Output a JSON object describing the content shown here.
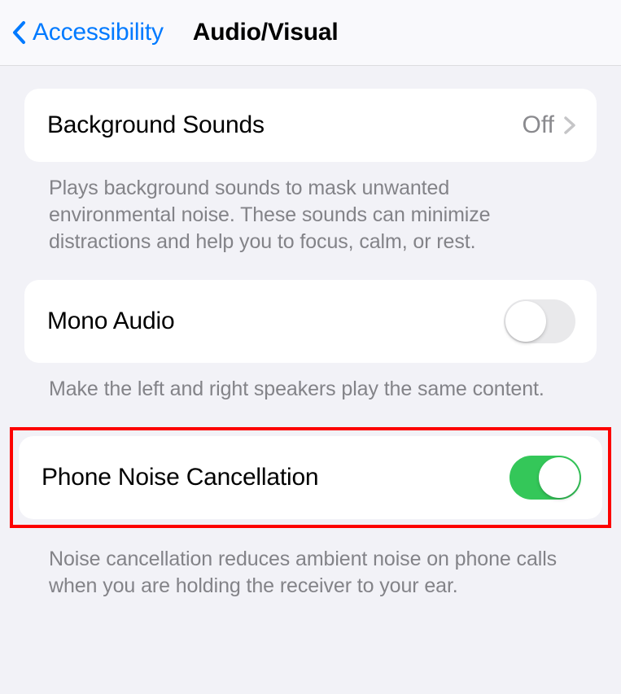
{
  "nav": {
    "back_label": "Accessibility",
    "title": "Audio/Visual"
  },
  "sections": {
    "background_sounds": {
      "title": "Background Sounds",
      "value": "Off",
      "footer": "Plays background sounds to mask unwanted environmental noise. These sounds can minimize distractions and help you to focus, calm, or rest."
    },
    "mono_audio": {
      "title": "Mono Audio",
      "enabled": false,
      "footer": "Make the left and right speakers play the same content."
    },
    "phone_noise_cancellation": {
      "title": "Phone Noise Cancellation",
      "enabled": true,
      "footer": "Noise cancellation reduces ambient noise on phone calls when you are holding the receiver to your ear."
    }
  }
}
